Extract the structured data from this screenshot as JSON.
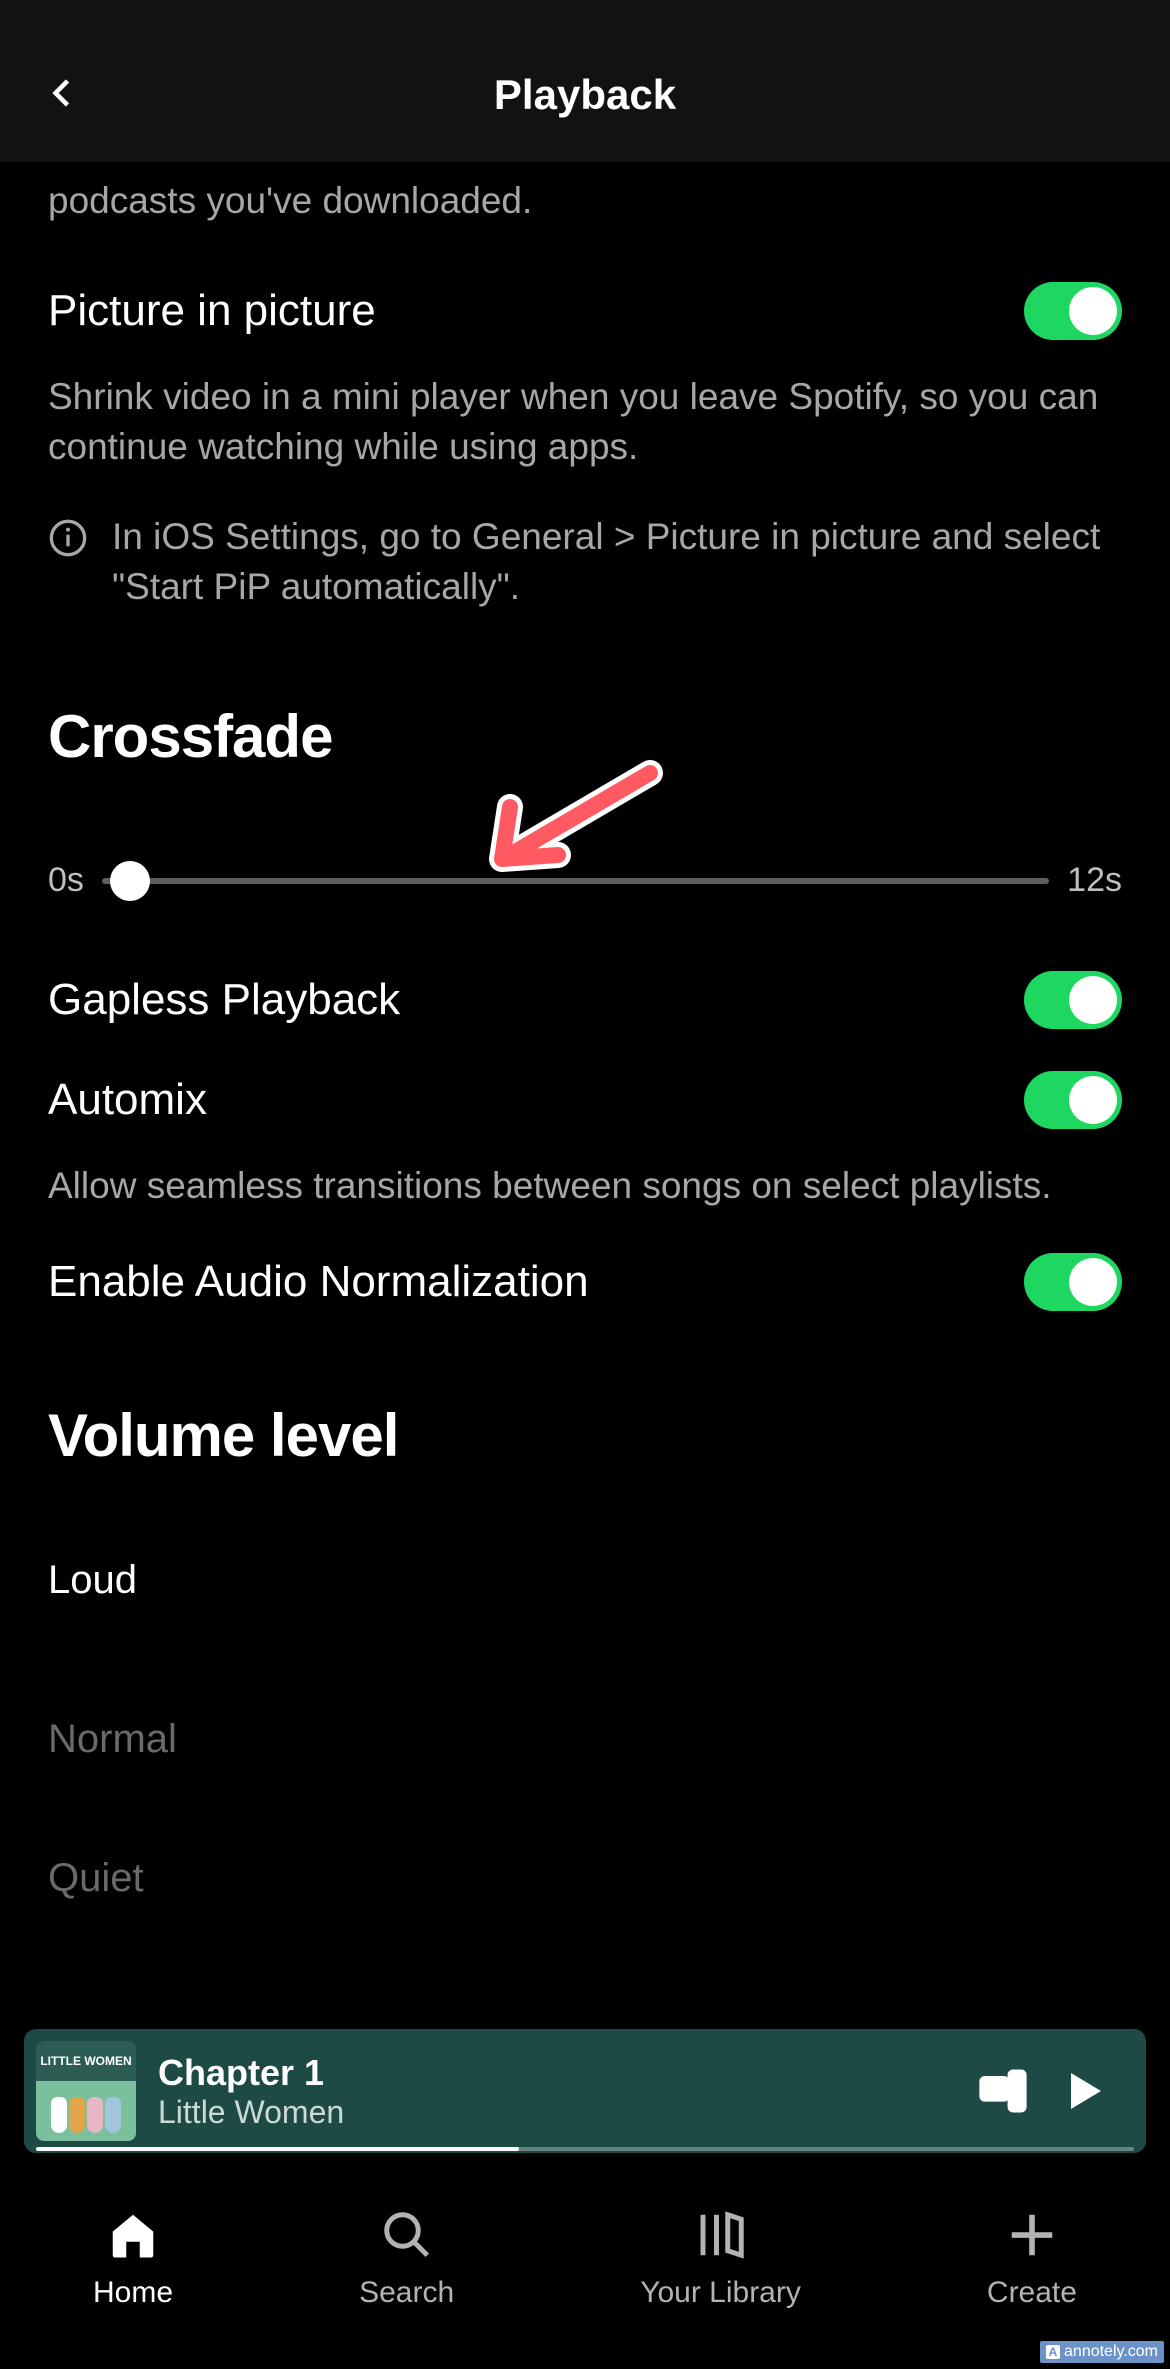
{
  "header": {
    "title": "Playback"
  },
  "partial_top": "podcasts you've downloaded.",
  "pip": {
    "title": "Picture in picture",
    "desc": "Shrink video in a mini player when you leave Spotify, so you can continue watching while using apps.",
    "info": "In iOS Settings, go to General > Picture in picture and select \"Start PiP automatically\".",
    "enabled": true
  },
  "crossfade": {
    "title": "Crossfade",
    "min_label": "0s",
    "max_label": "12s",
    "value": 0,
    "min": 0,
    "max": 12
  },
  "gapless": {
    "title": "Gapless Playback",
    "enabled": true
  },
  "automix": {
    "title": "Automix",
    "desc": "Allow seamless transitions between songs on select playlists.",
    "enabled": true
  },
  "normalization": {
    "title": "Enable Audio Normalization",
    "enabled": true
  },
  "volume": {
    "title": "Volume level",
    "options": [
      "Loud",
      "Normal",
      "Quiet"
    ],
    "selected": 1
  },
  "now_playing": {
    "track": "Chapter 1",
    "album": "Little Women",
    "art_text": "LITTLE WOMEN",
    "progress_pct": 44
  },
  "nav": {
    "items": [
      {
        "label": "Home",
        "active": true
      },
      {
        "label": "Search",
        "active": false
      },
      {
        "label": "Your Library",
        "active": false
      },
      {
        "label": "Create",
        "active": false
      }
    ]
  },
  "annotation": {
    "arrow_color": "#ff5a62"
  },
  "watermark": "annotely.com"
}
